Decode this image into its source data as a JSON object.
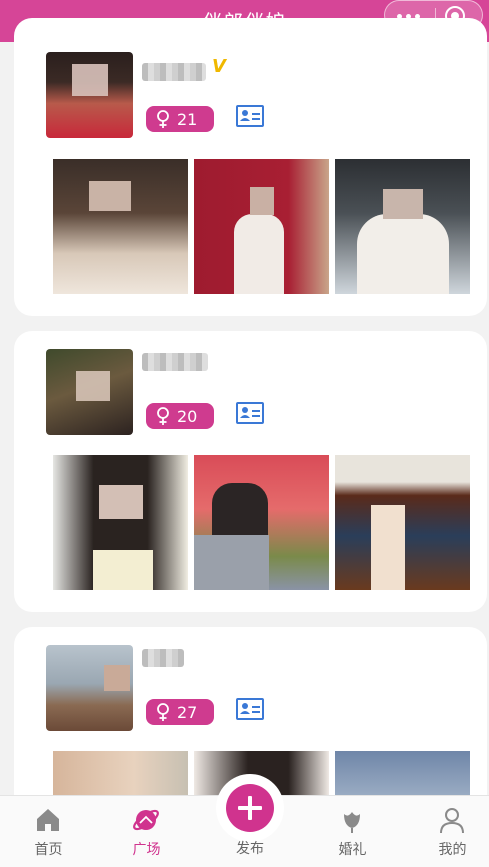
{
  "header": {
    "title": "伴郎伴娘"
  },
  "posts": [
    {
      "age": "21",
      "verified_badge": "V",
      "gender_icon": "female-icon",
      "id_icon": "id-card-icon"
    },
    {
      "age": "20",
      "gender_icon": "female-icon",
      "id_icon": "id-card-icon"
    },
    {
      "age": "27",
      "gender_icon": "female-icon",
      "id_icon": "id-card-icon"
    }
  ],
  "tabbar": {
    "items": [
      {
        "label": "首页",
        "icon": "home-icon",
        "active": false
      },
      {
        "label": "广场",
        "icon": "planet-icon",
        "active": true
      },
      {
        "label": "发布",
        "icon": "plus-icon",
        "active": false
      },
      {
        "label": "婚礼",
        "icon": "flower-icon",
        "active": false
      },
      {
        "label": "我的",
        "icon": "user-icon",
        "active": false
      }
    ]
  },
  "colors": {
    "brand": "#d64597",
    "accent": "#cf3b8f",
    "verified": "#f0b800",
    "id_blue": "#3a78d6"
  }
}
